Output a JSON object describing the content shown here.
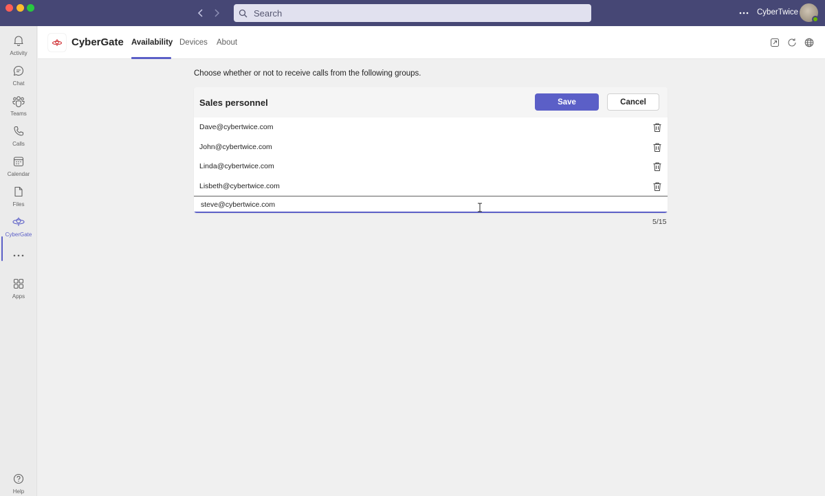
{
  "window": {
    "search_placeholder": "Search",
    "user_name": "CyberTwice"
  },
  "rail": {
    "items": [
      {
        "label": "Activity",
        "icon": "bell-icon"
      },
      {
        "label": "Chat",
        "icon": "chat-icon"
      },
      {
        "label": "Teams",
        "icon": "teams-icon"
      },
      {
        "label": "Calls",
        "icon": "phone-icon"
      },
      {
        "label": "Calendar",
        "icon": "calendar-icon"
      },
      {
        "label": "Files",
        "icon": "file-icon"
      },
      {
        "label": "CyberGate",
        "icon": "cybergate-icon",
        "active": true
      },
      {
        "label": "Apps",
        "icon": "apps-icon"
      }
    ],
    "help_label": "Help"
  },
  "app": {
    "name": "CyberGate",
    "tabs": [
      {
        "label": "Availability",
        "active": true
      },
      {
        "label": "Devices"
      },
      {
        "label": "About"
      }
    ]
  },
  "main": {
    "instructions": "Choose whether or not to receive calls from the following groups.",
    "group": {
      "title": "Sales personnel",
      "save_label": "Save",
      "cancel_label": "Cancel",
      "members": [
        "Dave@cybertwice.com",
        "John@cybertwice.com",
        "Linda@cybertwice.com",
        "Lisbeth@cybertwice.com"
      ],
      "new_entry_value": "steve@cybertwice.com",
      "counter": "5/15"
    }
  },
  "colors": {
    "titlebar": "#464775",
    "accent": "#5b5fc7",
    "brand_logo": "#d13438"
  }
}
